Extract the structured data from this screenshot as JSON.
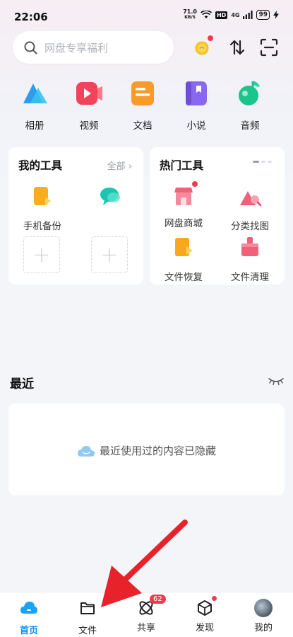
{
  "status_bar": {
    "time": "22:06",
    "net_speed_value": "71.0",
    "net_speed_unit": "KB/S",
    "hd_label": "HD",
    "network": "4G",
    "battery": "99"
  },
  "search": {
    "placeholder": "网盘专享福利"
  },
  "quick_nav": [
    {
      "label": "相册",
      "icon": "album-icon"
    },
    {
      "label": "视频",
      "icon": "video-icon"
    },
    {
      "label": "文档",
      "icon": "document-icon"
    },
    {
      "label": "小说",
      "icon": "novel-icon"
    },
    {
      "label": "音频",
      "icon": "audio-icon"
    }
  ],
  "my_tools": {
    "title": "我的工具",
    "more": "全部 ›",
    "items": [
      {
        "label": "手机备份",
        "icon": "phone-backup-icon"
      },
      {
        "label": "",
        "icon": "chat-icon"
      }
    ]
  },
  "hot_tools": {
    "title": "热门工具",
    "items": [
      {
        "label": "网盘商城",
        "icon": "store-icon"
      },
      {
        "label": "分类找图",
        "icon": "image-search-icon"
      },
      {
        "label": "文件恢复",
        "icon": "file-restore-icon"
      },
      {
        "label": "文件清理",
        "icon": "file-clean-icon"
      }
    ]
  },
  "recent": {
    "title": "最近",
    "empty_text": "最近使用过的内容已隐藏"
  },
  "bottom_nav": [
    {
      "label": "首页",
      "icon": "home-cloud-icon",
      "active": true
    },
    {
      "label": "文件",
      "icon": "folder-icon",
      "active": false
    },
    {
      "label": "共享",
      "icon": "share-atom-icon",
      "active": false,
      "badge": "62"
    },
    {
      "label": "发现",
      "icon": "discover-cube-icon",
      "active": false
    },
    {
      "label": "我的",
      "icon": "avatar",
      "active": false
    }
  ],
  "colors": {
    "accent": "#0a8cf0",
    "badge": "#ef3b4d",
    "annotation_arrow": "#e8222a"
  }
}
